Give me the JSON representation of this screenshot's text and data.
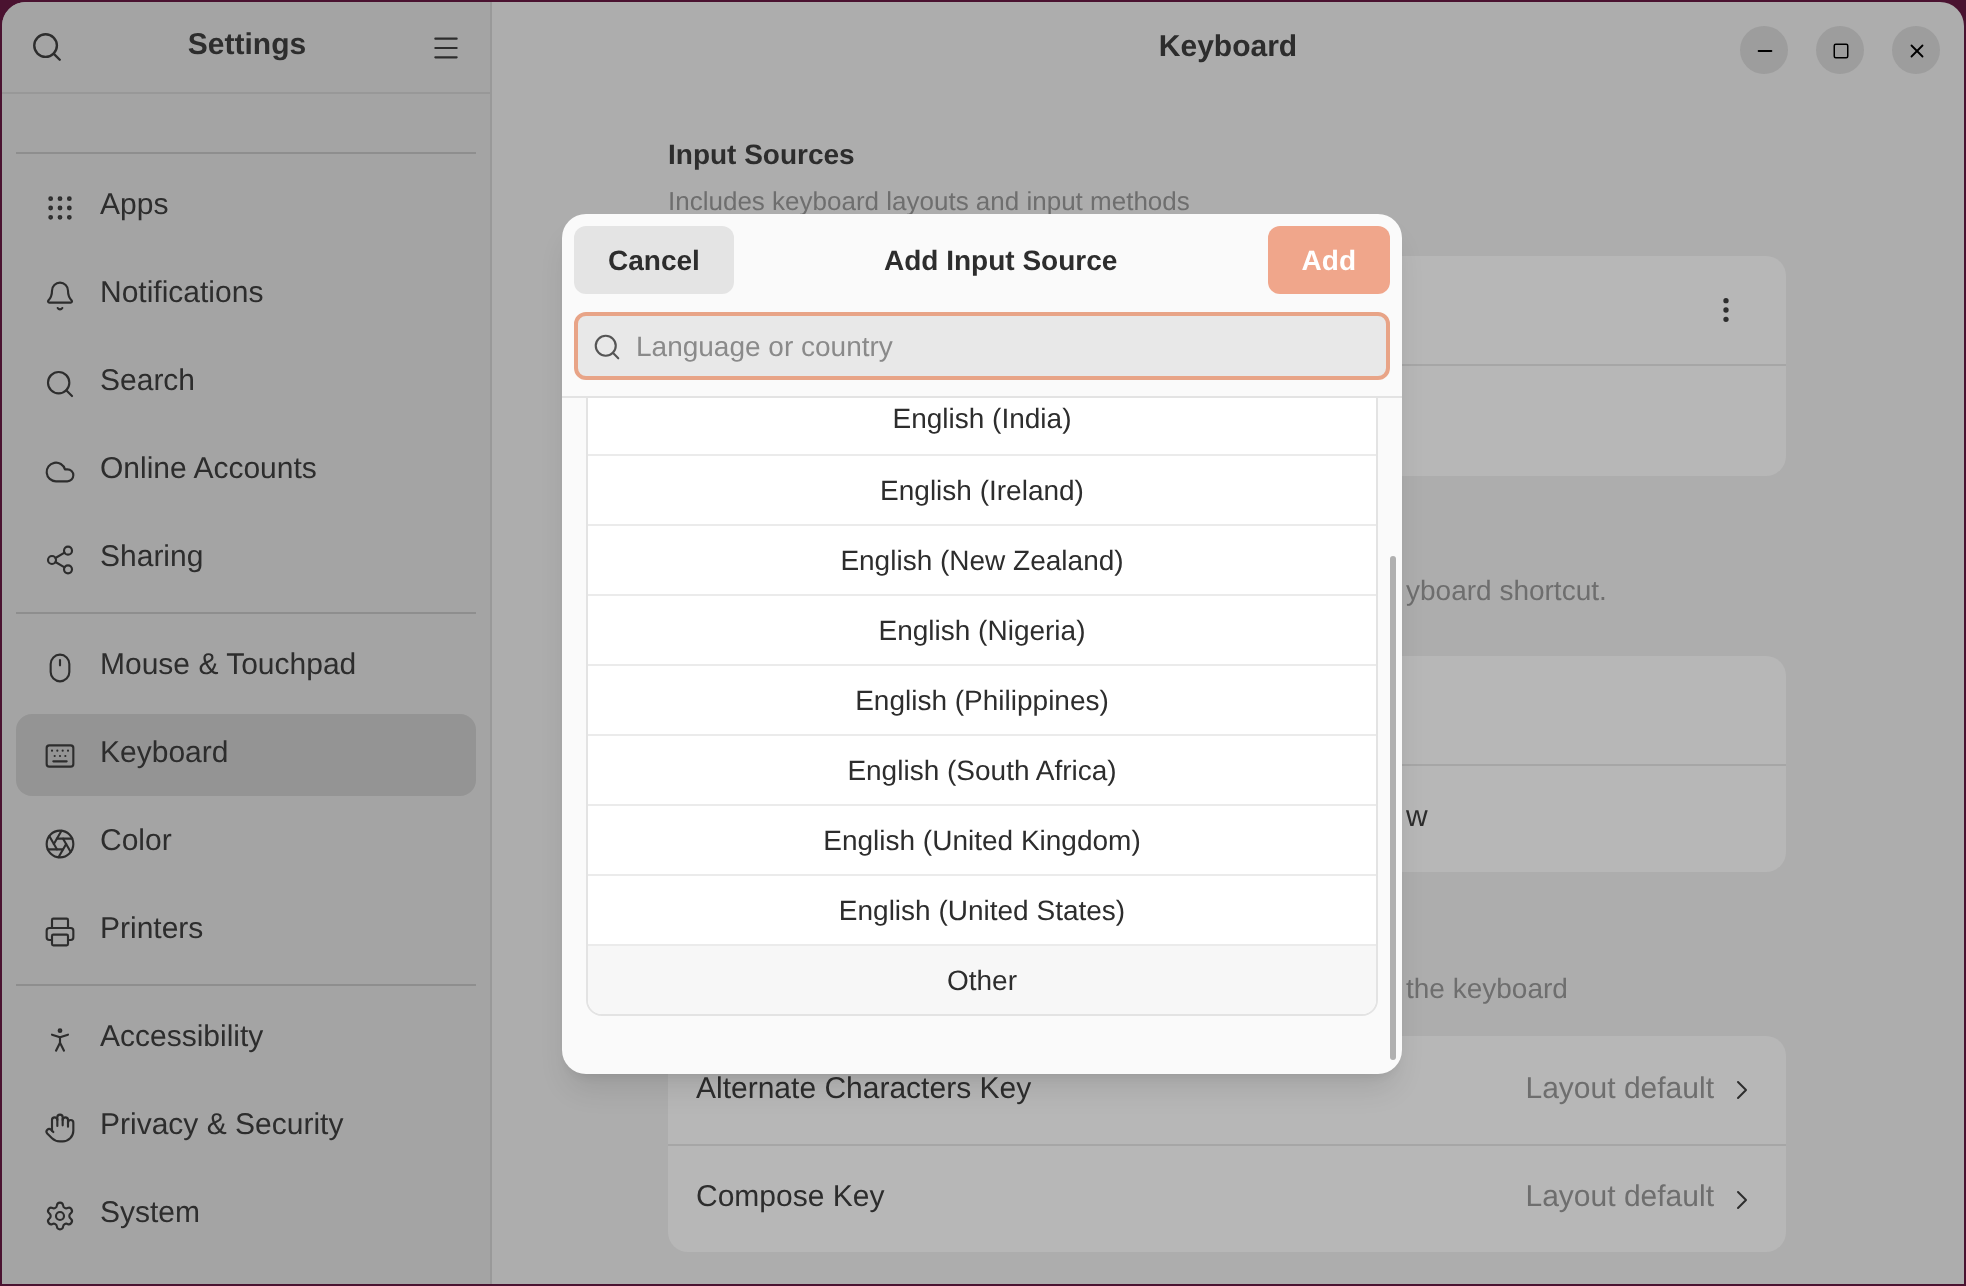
{
  "sidebar": {
    "title": "Settings",
    "groups": [
      {
        "items": [
          {
            "label": "Apps",
            "selected": false
          },
          {
            "label": "Notifications",
            "selected": false
          },
          {
            "label": "Search",
            "selected": false
          },
          {
            "label": "Online Accounts",
            "selected": false
          },
          {
            "label": "Sharing",
            "selected": false
          }
        ]
      },
      {
        "items": [
          {
            "label": "Mouse & Touchpad",
            "selected": false
          },
          {
            "label": "Keyboard",
            "selected": true
          },
          {
            "label": "Color",
            "selected": false
          },
          {
            "label": "Printers",
            "selected": false
          }
        ]
      },
      {
        "items": [
          {
            "label": "Accessibility",
            "selected": false
          },
          {
            "label": "Privacy & Security",
            "selected": false
          },
          {
            "label": "System",
            "selected": false
          }
        ]
      }
    ]
  },
  "window": {
    "title": "Keyboard"
  },
  "input_sources": {
    "heading": "Input Sources",
    "subtitle": "Includes keyboard layouts and input methods"
  },
  "switching_fragment": "yboard shortcut.",
  "switching_row_fragment": "w",
  "special_fragment": "the keyboard",
  "special_rows": [
    {
      "label": "Alternate Characters Key",
      "value": "Layout default"
    },
    {
      "label": "Compose Key",
      "value": "Layout default"
    }
  ],
  "dialog": {
    "title": "Add Input Source",
    "cancel": "Cancel",
    "add": "Add",
    "add_disabled": true,
    "search": {
      "placeholder": "Language or country"
    },
    "items": [
      {
        "label": "English (India)",
        "kind": "language"
      },
      {
        "label": "English (Ireland)",
        "kind": "language"
      },
      {
        "label": "English (New Zealand)",
        "kind": "language"
      },
      {
        "label": "English (Nigeria)",
        "kind": "language"
      },
      {
        "label": "English (Philippines)",
        "kind": "language"
      },
      {
        "label": "English (South Africa)",
        "kind": "language"
      },
      {
        "label": "English (United Kingdom)",
        "kind": "language"
      },
      {
        "label": "English (United States)",
        "kind": "language"
      },
      {
        "label": "Other",
        "kind": "more"
      }
    ]
  }
}
